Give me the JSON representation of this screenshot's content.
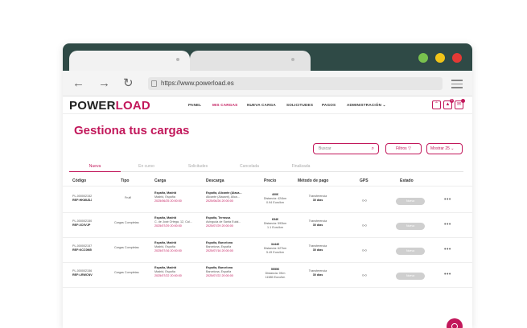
{
  "browser": {
    "url": "https://www.powerload.es",
    "colors": {
      "titlebar": "#2f4a46",
      "light_green": "#79c14e",
      "light_yellow": "#f0c419",
      "light_red": "#e53935"
    }
  },
  "app": {
    "logo_a": "POWER",
    "logo_b": "LOAD",
    "nav": [
      "PANEL",
      "MIS CARGAS",
      "NUEVA CARGA",
      "SOLICITUDES",
      "PAGOS",
      "ADMINISTRACIÓN"
    ],
    "active_nav": "MIS CARGAS",
    "notif_count": "3",
    "accent": "#c2185b"
  },
  "page": {
    "title": "Gestiona tus cargas",
    "search_placeholder": "Buscar",
    "filters_label": "Filtros",
    "show_label": "Mostrar 25",
    "tabs": [
      "Nueva",
      "En curso",
      "Solicitudes",
      "Cancelada",
      "Finalizada"
    ],
    "active_tab": "Nueva",
    "columns": [
      "Código",
      "Tipo",
      "Carga",
      "Descarga",
      "Precio",
      "Método de pago",
      "GPS",
      "Estado"
    ]
  },
  "rows": [
    {
      "code": "PL-000002152",
      "ref": "REF:HKMUDJ",
      "type": "Frutfl",
      "load_city": "España, Madrid",
      "load_addr": "Madrid, España",
      "load_time": "2025/06/25 20:00:00",
      "unload_city": "España, Alicante (Alaca...",
      "unload_addr": "Alicante (Alacant), Alica...",
      "unload_time": "2025/06/26 20:00:00",
      "price": "400€",
      "distance": "Distancia: 424km",
      "per_km": "0.94 Euro/km",
      "pay_method": "Transferencia",
      "pay_days": "30 días",
      "status": "Nueva"
    },
    {
      "code": "PL-000002150",
      "ref": "REF:2C9VJP",
      "type": "Cargas Completas",
      "load_city": "España, Madrid",
      "load_addr": "C. de José Ortega, 12, Cal...",
      "load_time": "2025/07/29 20:00:00",
      "unload_city": "España, Terrassa",
      "unload_addr": "Avinguda de Santa Eulal...",
      "unload_time": "2025/07/29 20:00:00",
      "price": "654€",
      "distance": "Distancia: 593km",
      "per_km": "1.1 Euro/km",
      "pay_method": "Transferencia",
      "pay_days": "30 días",
      "status": "Nueva"
    },
    {
      "code": "PL-000002157",
      "ref": "REF:KCC0M5",
      "type": "Cargas Completas",
      "load_city": "España, Madrid",
      "load_addr": "Madrid, España",
      "load_time": "2025/07/16 20:00:00",
      "unload_city": "España, Barcelona",
      "unload_addr": "Barcelona, España",
      "unload_time": "2025/07/16 20:00:00",
      "price": "3444€",
      "distance": "Distancia: 627km",
      "per_km": "5.49 Euro/km",
      "pay_method": "Transferencia",
      "pay_days": "30 días",
      "status": "Nueva"
    },
    {
      "code": "PL-000002156",
      "ref": "REF:LRWCNV",
      "type": "Cargas Completas",
      "load_city": "España, Madrid",
      "load_addr": "Madrid, España",
      "load_time": "2025/07/22 20:00:00",
      "unload_city": "España, Barcelona",
      "unload_addr": "Barcelona, España",
      "unload_time": "2025/07/22 20:00:00",
      "price": "5555€",
      "distance": "Distancia: 0Km",
      "per_km": "11585 Euro/km",
      "pay_method": "Transferencia",
      "pay_days": "30 días",
      "status": "Nueva"
    }
  ]
}
